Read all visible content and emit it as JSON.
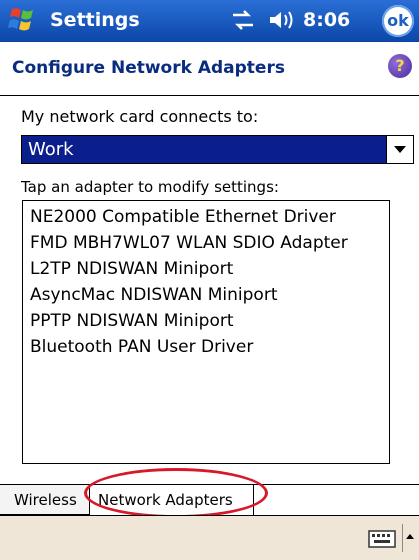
{
  "titlebar": {
    "app_title": "Settings",
    "clock": "8:06",
    "ok_label": "ok",
    "icons": [
      "start-flag-icon",
      "connectivity-icon",
      "volume-icon"
    ]
  },
  "header": {
    "title": "Configure Network Adapters",
    "help_label": "?"
  },
  "form": {
    "connects_label": "My network card connects to:",
    "connects_value": "Work",
    "list_label": "Tap an adapter to modify settings:",
    "adapters": [
      "NE2000 Compatible Ethernet Driver",
      "FMD MBH7WL07 WLAN SDIO Adapter",
      "L2TP NDISWAN Miniport",
      "AsyncMac NDISWAN Miniport",
      "PPTP NDISWAN Miniport",
      "Bluetooth PAN User Driver"
    ]
  },
  "tabs": [
    {
      "label": "Wireless"
    },
    {
      "label": "Network Adapters",
      "selected": true
    }
  ],
  "colors": {
    "titlebar": "#0c46a8",
    "selection": "#0b1f8c",
    "highlight": "#d8192a"
  }
}
